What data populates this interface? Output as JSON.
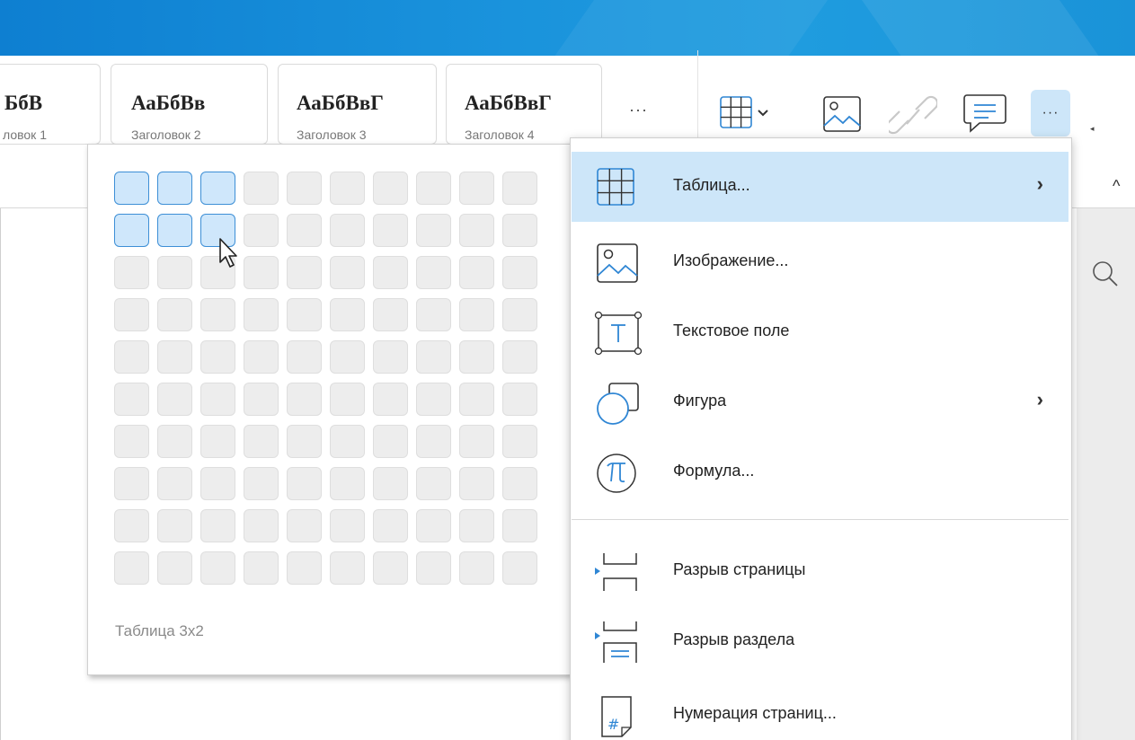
{
  "ribbon": {
    "styles": [
      {
        "sample": "БбВ",
        "caption": "ловок 1"
      },
      {
        "sample": "АаБбВв",
        "caption": "Заголовок 2"
      },
      {
        "sample": "АаБбВвГ",
        "caption": "Заголовок 3"
      },
      {
        "sample": "АаБбВвГ",
        "caption": "Заголовок 4"
      }
    ],
    "more_styles": "···",
    "more_tools": "···",
    "scroll_arrow": "◂",
    "collapse_caret": "^"
  },
  "table_picker": {
    "columns": 10,
    "rows": 10,
    "selected_columns": 3,
    "selected_rows": 2,
    "caption": "Таблица 3x2"
  },
  "insert_menu": {
    "items": [
      {
        "label": "Таблица...",
        "icon": "table-icon",
        "submenu": "›"
      },
      {
        "label": "Изображение...",
        "icon": "image-icon"
      },
      {
        "label": "Текстовое поле",
        "icon": "text-box-icon"
      },
      {
        "label": "Фигура",
        "icon": "shape-icon",
        "submenu": "›"
      },
      {
        "label": "Формула...",
        "icon": "formula-icon"
      },
      {
        "label": "Разрыв страницы",
        "icon": "page-break-icon"
      },
      {
        "label": "Разрыв раздела",
        "icon": "section-break-icon"
      },
      {
        "label": "Нумерация страниц...",
        "icon": "page-number-icon"
      }
    ]
  },
  "colors": {
    "accent": "#3d8fd6",
    "highlight": "#cde6f9",
    "titlebar": "#1a93dc"
  }
}
